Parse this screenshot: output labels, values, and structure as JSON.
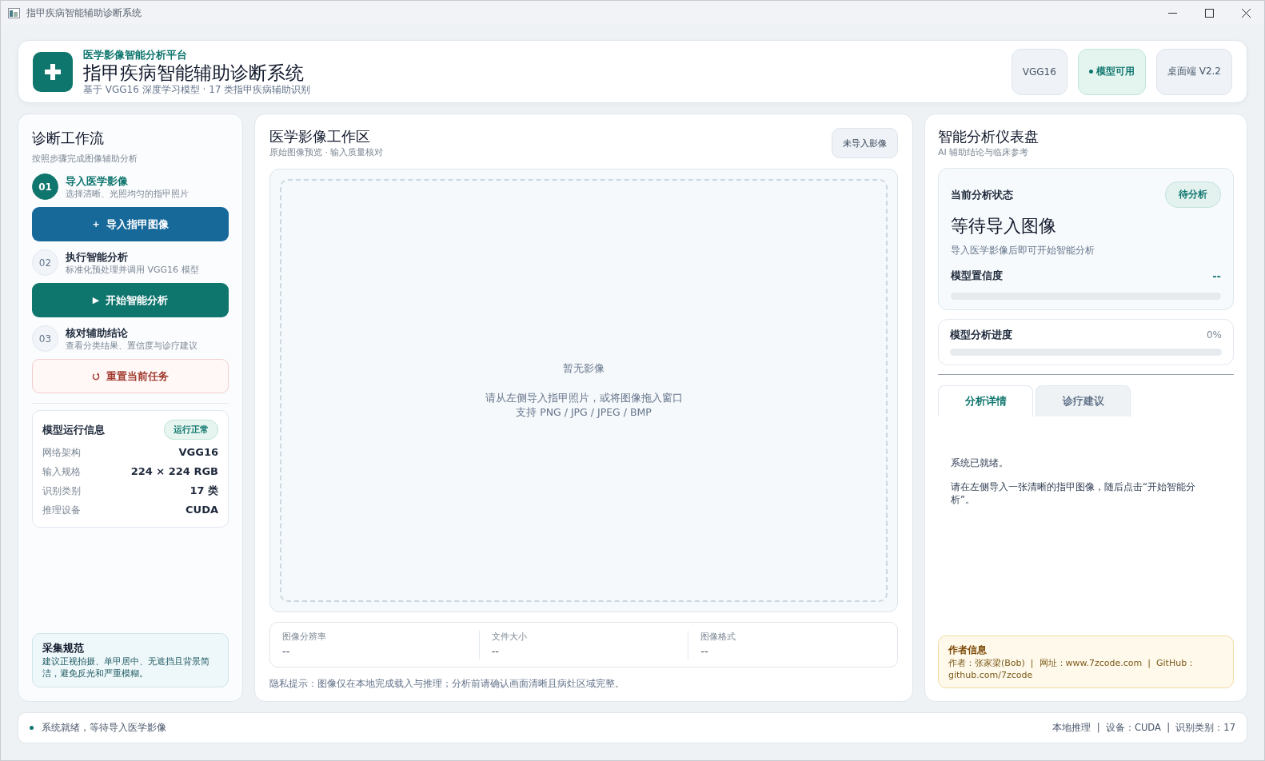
{
  "window": {
    "title": "指甲疾病智能辅助诊断系统"
  },
  "header": {
    "eyebrow": "医学影像智能分析平台",
    "title": "指甲疾病智能辅助诊断系统",
    "subtitle": "基于 VGG16 深度学习模型 · 17 类指甲疾病辅助识别",
    "badges": [
      {
        "label": "VGG16",
        "kind": "plain"
      },
      {
        "label": "模型可用",
        "kind": "status"
      },
      {
        "label": "桌面端 V2.2",
        "kind": "plain"
      }
    ]
  },
  "workflow": {
    "title": "诊断工作流",
    "subtitle": "按照步骤完成图像辅助分析",
    "steps": [
      {
        "number": "01",
        "title": "导入医学影像",
        "desc": "选择清晰、光照均匀的指甲照片",
        "active": true,
        "button": {
          "icon": "+",
          "label": "导入指甲图像",
          "kind": "primary"
        }
      },
      {
        "number": "02",
        "title": "执行智能分析",
        "desc": "标准化预处理并调用 VGG16 模型",
        "active": false,
        "button": {
          "icon": "▶",
          "label": "开始智能分析",
          "kind": "accent"
        }
      },
      {
        "number": "03",
        "title": "核对辅助结论",
        "desc": "查看分类结果、置信度与诊疗建议",
        "active": false,
        "button": {
          "label": "重置当前任务",
          "kind": "danger"
        }
      }
    ],
    "model_info": {
      "title": "模型运行信息",
      "status": "运行正常",
      "rows": [
        {
          "label": "网络架构",
          "value": "VGG16"
        },
        {
          "label": "输入规格",
          "value": "224 × 224 RGB"
        },
        {
          "label": "识别类别",
          "value": "17 类"
        },
        {
          "label": "推理设备",
          "value": "CUDA"
        }
      ]
    },
    "guide": {
      "title": "采集规范",
      "text": "建议正视拍摄、单甲居中、无遮挡且背景简洁，避免反光和严重模糊。"
    }
  },
  "workspace": {
    "title": "医学影像工作区",
    "subtitle": "原始图像预览 · 输入质量核对",
    "status": "未导入影像",
    "drop": {
      "title": "暂无影像",
      "hint": "请从左侧导入指甲照片，或将图像拖入窗口",
      "formats": "支持 PNG / JPG / JPEG / BMP"
    },
    "info": [
      {
        "label": "图像分辨率",
        "value": "--"
      },
      {
        "label": "文件大小",
        "value": "--"
      },
      {
        "label": "图像格式",
        "value": "--"
      }
    ],
    "note": "隐私提示：图像仅在本地完成载入与推理；分析前请确认画面清晰且病灶区域完整。"
  },
  "dashboard": {
    "title": "智能分析仪表盘",
    "subtitle": "AI 辅助结论与临床参考",
    "status_card": {
      "label": "当前分析状态",
      "badge": "待分析",
      "headline": "等待导入图像",
      "desc": "导入医学影像后即可开始智能分析",
      "confidence_label": "模型置信度",
      "confidence_value": "--",
      "level": 0
    },
    "progress": {
      "label": "模型分析进度",
      "value": "0%",
      "level": 0
    },
    "tabs": [
      {
        "label": "分析详情",
        "selected": true
      },
      {
        "label": "诊疗建议",
        "selected": false
      }
    ],
    "details": [
      "系统已就绪。",
      "请在左侧导入一张清晰的指甲图像，随后点击“开始智能分析”。"
    ],
    "author": {
      "title": "作者信息",
      "text": "作者：张家梁(Bob)  |  网址：www.7zcode.com  |  GitHub：github.com/7zcode"
    }
  },
  "status_bar": {
    "message": "系统就绪，等待导入医学影像",
    "info": "本地推理  |  设备：CUDA  |  识别类别：17"
  }
}
